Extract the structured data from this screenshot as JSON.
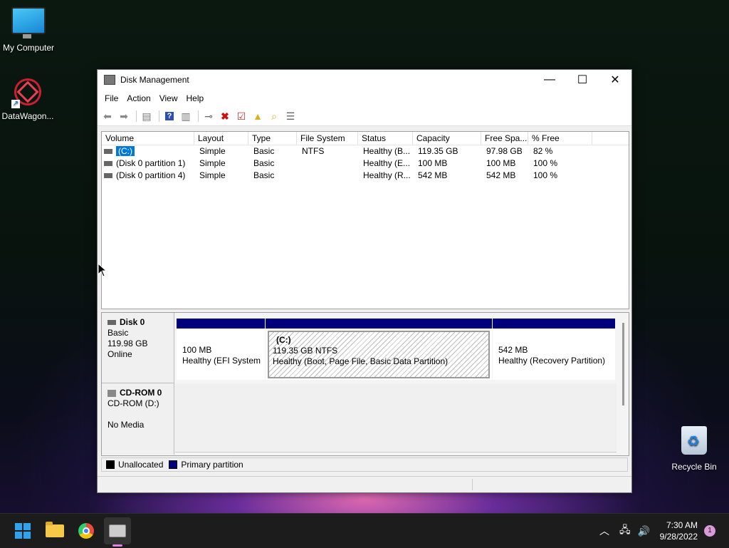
{
  "desktop": {
    "icons": [
      {
        "label": "My Computer"
      },
      {
        "label": "DataWagon..."
      },
      {
        "label": "Recycle Bin"
      }
    ]
  },
  "window": {
    "title": "Disk Management",
    "controls": {
      "minimize": "—",
      "maximize": "☐",
      "close": "✕"
    },
    "menu": [
      "File",
      "Action",
      "View",
      "Help"
    ],
    "toolbar_icons": [
      "back-icon",
      "forward-icon",
      "console-tree-icon",
      "help-icon",
      "properties-icon",
      "connect-icon",
      "delete-icon",
      "check-icon",
      "up-icon",
      "search-icon",
      "settings-icon"
    ]
  },
  "volume_list": {
    "columns": [
      "Volume",
      "Layout",
      "Type",
      "File System",
      "Status",
      "Capacity",
      "Free Spa...",
      "% Free"
    ],
    "rows": [
      [
        "(C:)",
        "Simple",
        "Basic",
        "NTFS",
        "Healthy (B...",
        "119.35 GB",
        "97.98 GB",
        "82 %"
      ],
      [
        "(Disk 0 partition 1)",
        "Simple",
        "Basic",
        "",
        "Healthy (E...",
        "100 MB",
        "100 MB",
        "100 %"
      ],
      [
        "(Disk 0 partition 4)",
        "Simple",
        "Basic",
        "",
        "Healthy (R...",
        "542 MB",
        "542 MB",
        "100 %"
      ]
    ]
  },
  "disks": [
    {
      "name": "Disk 0",
      "type": "Basic",
      "size": "119.98 GB",
      "state": "Online",
      "partitions": [
        {
          "label": "",
          "size": "100 MB",
          "status": "Healthy (EFI System Partition)"
        },
        {
          "label": "(C:)",
          "size": "119.35 GB NTFS",
          "status": "Healthy (Boot, Page File, Basic Data Partition)"
        },
        {
          "label": "",
          "size": "542 MB",
          "status": "Healthy (Recovery Partition)"
        }
      ]
    },
    {
      "name": "CD-ROM 0",
      "type": "CD-ROM (D:)",
      "size": "",
      "state": "No Media"
    }
  ],
  "legend": [
    {
      "label": "Unallocated",
      "color": "#000000"
    },
    {
      "label": "Primary partition",
      "color": "#00007c"
    }
  ],
  "taskbar": {
    "apps": [
      "start-icon",
      "file-explorer-icon",
      "chrome-icon",
      "disk-management-icon"
    ],
    "time": "7:30 AM",
    "date": "9/28/2022",
    "notification_count": "1"
  }
}
